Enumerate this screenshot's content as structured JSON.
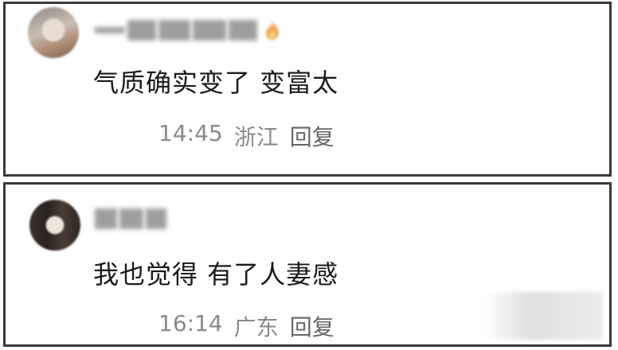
{
  "comments": [
    {
      "text": "气质确实变了 变富太",
      "time": "14:45",
      "location": "浙江",
      "reply_label": "回复"
    },
    {
      "text": "我也觉得 有了人妻感",
      "time": "16:14",
      "location": "广东",
      "reply_label": "回复"
    }
  ]
}
